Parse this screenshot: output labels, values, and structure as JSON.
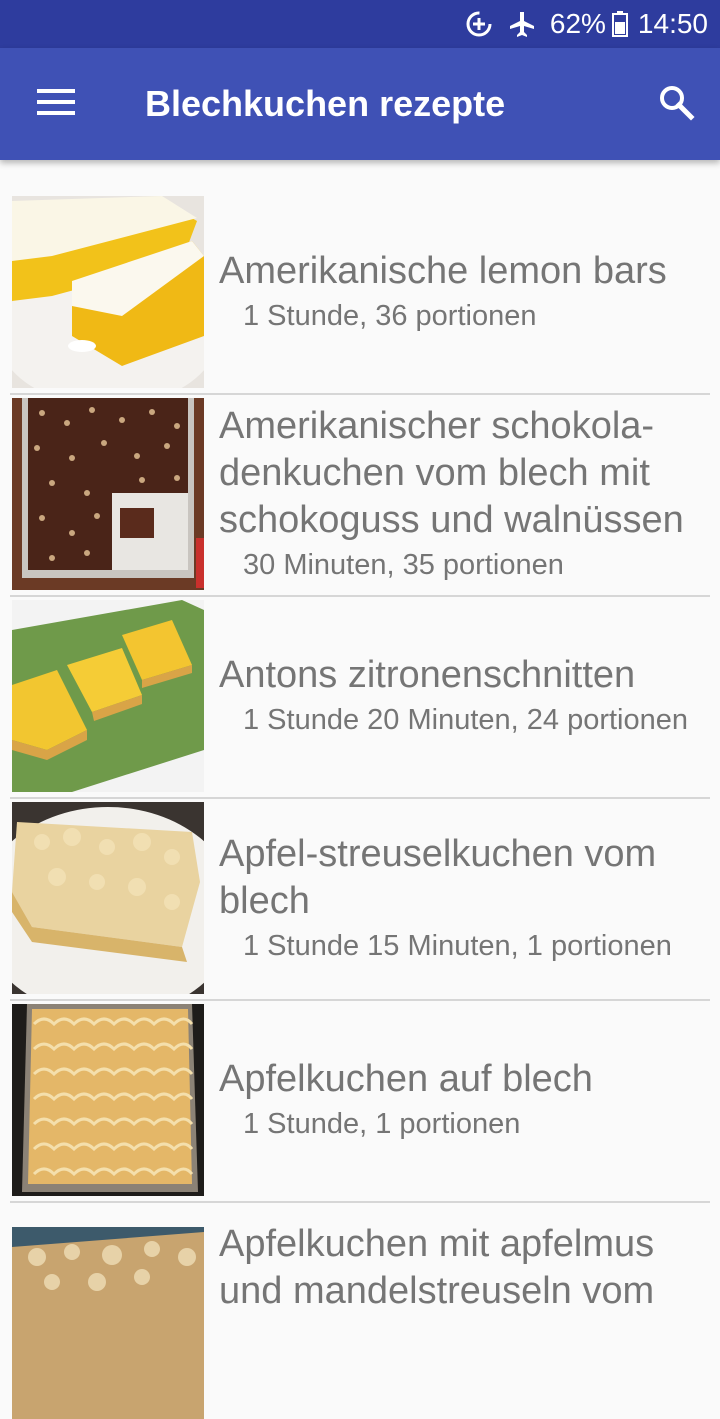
{
  "status_bar": {
    "battery": "62%",
    "time": "14:50",
    "icons": [
      "data-saver-icon",
      "airplane-mode-icon",
      "battery-icon"
    ]
  },
  "app_bar": {
    "title": "Blechkuchen rezepte",
    "menu_icon": "hamburger-menu-icon",
    "search_icon": "search-icon",
    "color": "#3f51b5",
    "status_color": "#2e3c9e"
  },
  "recipes": [
    {
      "title": "Amerikanische lemon bars",
      "meta": "1 Stunde, 36 portionen",
      "image": "lemon-bars-photo"
    },
    {
      "title": "Amerikanischer schokola-denkuchen vom blech mit schokoguss und walnüssen",
      "meta": "30 Minuten, 35 portionen",
      "image": "chocolate-sheet-cake-photo"
    },
    {
      "title": "Antons zitronenschnitten",
      "meta": "1 Stunde 20 Minuten, 24 portionen",
      "image": "lemon-slices-photo"
    },
    {
      "title": "Apfel-streuselkuchen vom blech",
      "meta": "1 Stunde 15 Minuten, 1 portionen",
      "image": "apple-crumble-cake-photo"
    },
    {
      "title": "Apfelkuchen auf blech",
      "meta": "1 Stunde, 1 portionen",
      "image": "apple-sheet-cake-photo"
    },
    {
      "title": "Apfelkuchen mit apfelmus und mandelstreuseln vom",
      "meta": "",
      "image": "apple-almond-crumble-photo"
    }
  ]
}
